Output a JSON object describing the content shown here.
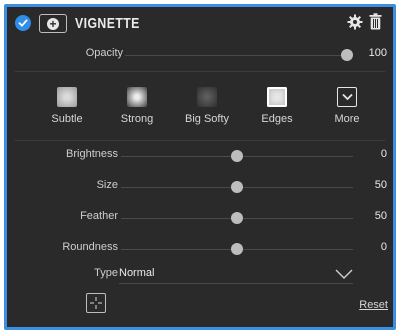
{
  "header": {
    "title": "VIGNETTE",
    "icons": [
      "check-circle-icon",
      "add-icon",
      "gear-icon",
      "trash-icon"
    ]
  },
  "opacity": {
    "label": "Opacity",
    "value": "100",
    "level": 1.0
  },
  "presets": [
    {
      "label": "Subtle",
      "icon": "subtle-preset-icon"
    },
    {
      "label": "Strong",
      "icon": "strong-preset-icon"
    },
    {
      "label": "Big Softy",
      "icon": "big-softy-preset-icon"
    },
    {
      "label": "Edges",
      "icon": "edges-preset-icon"
    },
    {
      "label": "More",
      "icon": "chevron-down-icon"
    }
  ],
  "sliders": [
    {
      "label": "Brightness",
      "value": "0",
      "level": 0.5
    },
    {
      "label": "Size",
      "value": "50",
      "level": 0.5
    },
    {
      "label": "Feather",
      "value": "50",
      "level": 0.5
    },
    {
      "label": "Roundness",
      "value": "0",
      "level": 0.5
    }
  ],
  "type": {
    "label": "Type",
    "value": "Normal"
  },
  "footer": {
    "reset_label": "Reset"
  },
  "colors": {
    "accent": "#3b8fde",
    "panel_bg": "#2a2a2a",
    "thumb": "#bdbdbd"
  }
}
